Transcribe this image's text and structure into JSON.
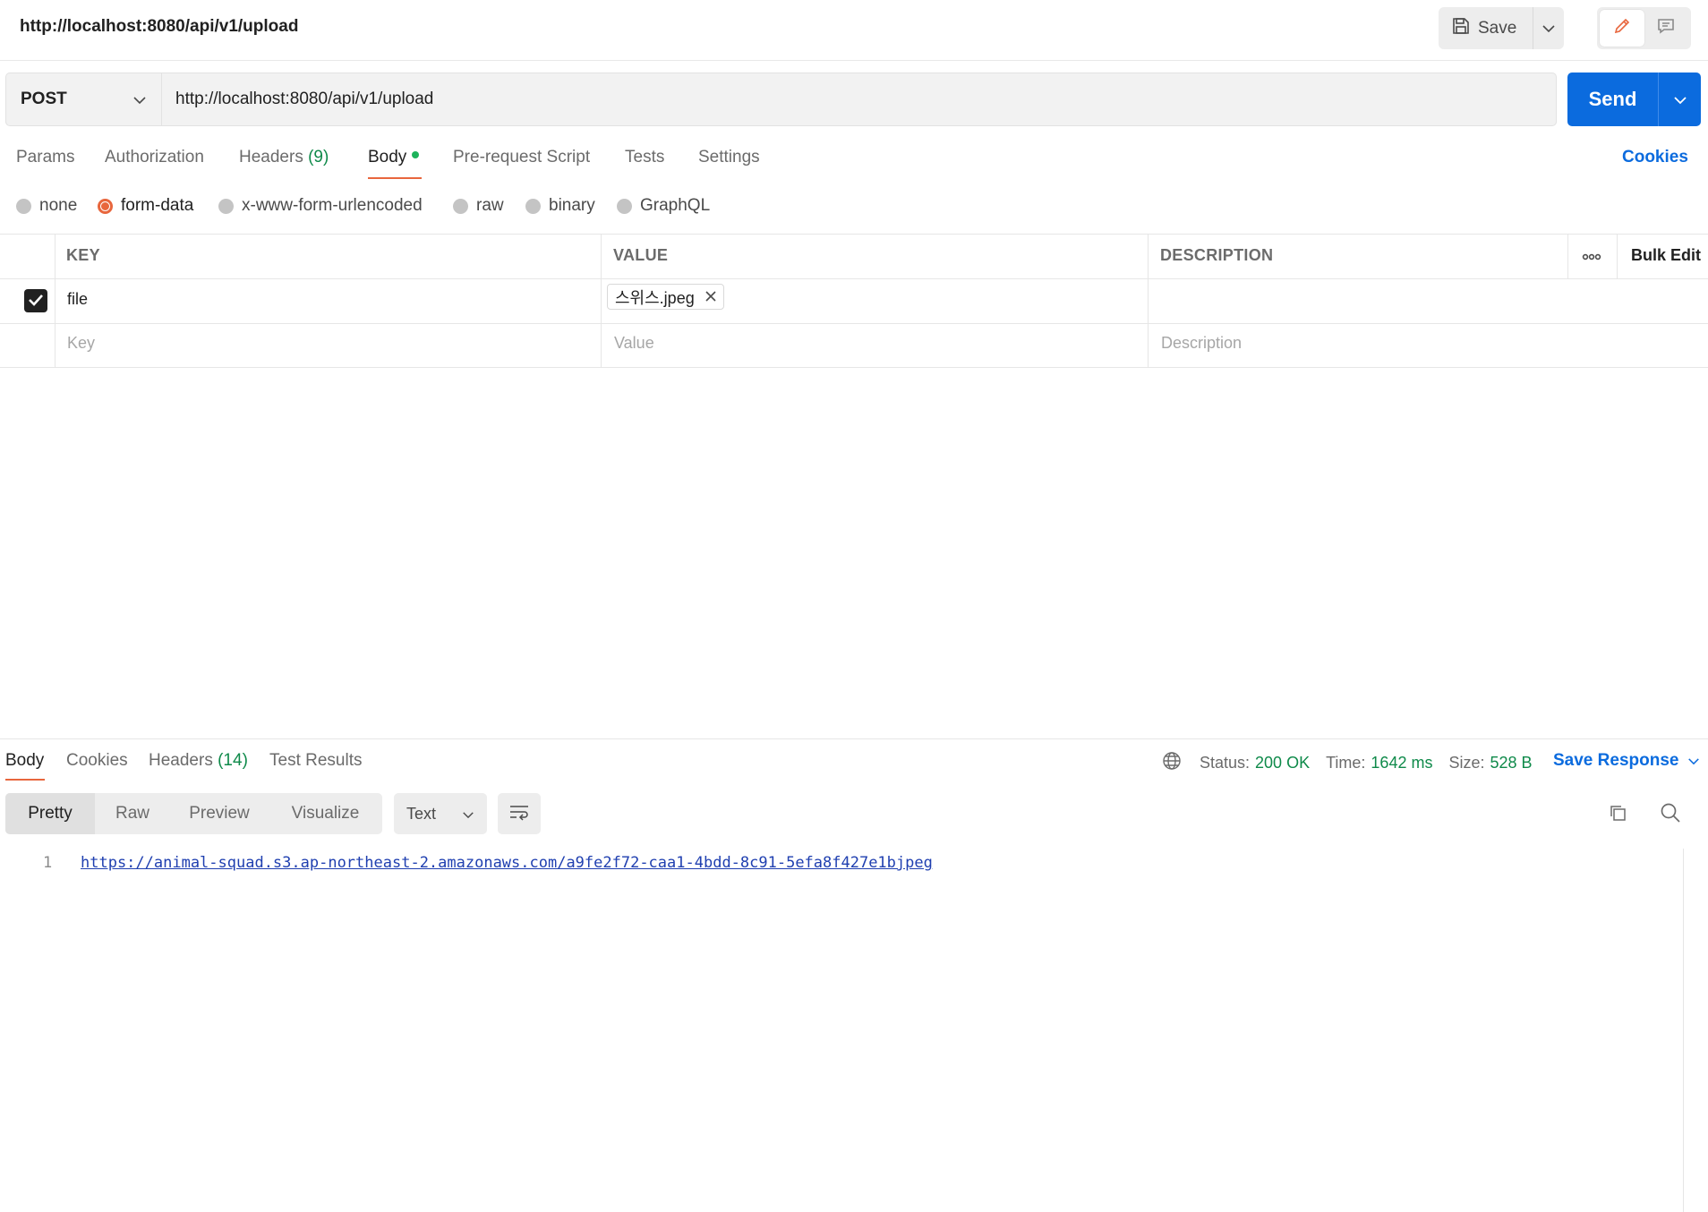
{
  "header": {
    "title": "http://localhost:8080/api/v1/upload",
    "save_label": "Save"
  },
  "request": {
    "method": "POST",
    "url": "http://localhost:8080/api/v1/upload",
    "send_label": "Send"
  },
  "tabs": {
    "params": "Params",
    "authorization": "Authorization",
    "headers_label": "Headers",
    "headers_count": "(9)",
    "body": "Body",
    "pre_request": "Pre-request Script",
    "tests": "Tests",
    "settings": "Settings",
    "cookies": "Cookies"
  },
  "body_types": {
    "none": "none",
    "form_data": "form-data",
    "urlencoded": "x-www-form-urlencoded",
    "raw": "raw",
    "binary": "binary",
    "graphql": "GraphQL",
    "selected": "form-data"
  },
  "table": {
    "headers": {
      "key": "KEY",
      "value": "VALUE",
      "description": "DESCRIPTION",
      "bulk_edit": "Bulk Edit"
    },
    "rows": [
      {
        "checked": true,
        "key": "file",
        "value": "스위스.jpeg",
        "description": ""
      }
    ],
    "placeholders": {
      "key": "Key",
      "value": "Value",
      "description": "Description"
    }
  },
  "response": {
    "tabs": {
      "body": "Body",
      "cookies": "Cookies",
      "headers_label": "Headers",
      "headers_count": "(14)",
      "test_results": "Test Results"
    },
    "status_label": "Status:",
    "status_value": "200 OK",
    "time_label": "Time:",
    "time_value": "1642 ms",
    "size_label": "Size:",
    "size_value": "528 B",
    "save_response": "Save Response",
    "views": {
      "pretty": "Pretty",
      "raw": "Raw",
      "preview": "Preview",
      "visualize": "Visualize"
    },
    "format": "Text",
    "line_number": "1",
    "body_text": "https://animal-squad.s3.ap-northeast-2.amazonaws.com/a9fe2f72-caa1-4bdd-8c91-5efa8f427e1bjpeg"
  },
  "colors": {
    "accent": "#e8663d",
    "primary": "#0b6bde",
    "success": "#0f8a4a"
  }
}
